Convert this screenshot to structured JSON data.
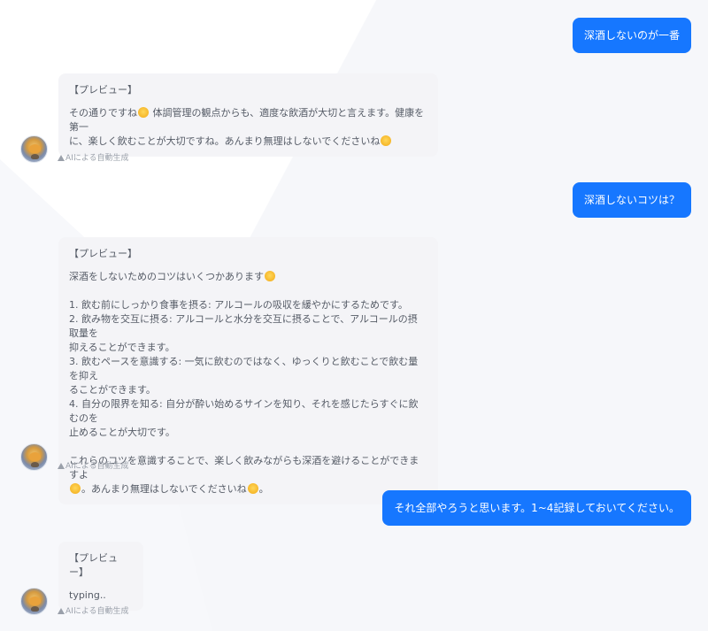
{
  "messages": [
    {
      "role": "user",
      "text": "深酒しないのが一番"
    },
    {
      "role": "ai",
      "header": "【プレビュー】",
      "lines": [
        [
          "その通りですね",
          "emoji",
          " 体調管理の観点からも、適度な飲酒が大切と言えます。健康を第一"
        ],
        [
          "に、楽しく飲むことが大切ですね。あんまり無理はしないでくださいね",
          "emoji"
        ]
      ],
      "note": "AIによる自動生成"
    },
    {
      "role": "user",
      "text": "深酒しないコツは？"
    },
    {
      "role": "ai",
      "header": "【プレビュー】",
      "lines": [
        [
          "深酒をしないためのコツはいくつかあります",
          "emoji"
        ],
        [
          ""
        ],
        [
          "1. 飲む前にしっかり食事を摂る: アルコールの吸収を緩やかにするためです。"
        ],
        [
          "2. 飲み物を交互に摂る: アルコールと水分を交互に摂ることで、アルコールの摂取量を"
        ],
        [
          "抑えることができます。"
        ],
        [
          "3. 飲むペースを意識する: 一気に飲むのではなく、ゆっくりと飲むことで飲む量を抑え"
        ],
        [
          "ることができます。"
        ],
        [
          "4. 自分の限界を知る: 自分が酔い始めるサインを知り、それを感じたらすぐに飲むのを"
        ],
        [
          "止めることが大切です。"
        ],
        [
          ""
        ],
        [
          "これらのコツを意識することで、楽しく飲みながらも深酒を避けることができますよ"
        ],
        [
          "emoji",
          "。あんまり無理はしないでくださいね",
          "emoji",
          "。"
        ]
      ],
      "note": "AIによる自動生成"
    },
    {
      "role": "user",
      "text": "それ全部やろうと思います。1~4記録しておいてください。"
    },
    {
      "role": "ai",
      "header": "【プレビュー】",
      "lines": [
        [
          "typing.."
        ]
      ],
      "note": "AIによる自動生成"
    }
  ],
  "icons": {
    "emoji": "smiling-face-icon",
    "note": "warning-icon",
    "avatar": "bot-avatar"
  },
  "colors": {
    "user_bubble": "#1677ff",
    "ai_bubble": "#f4f4f7",
    "note": "#9aa0aa"
  }
}
